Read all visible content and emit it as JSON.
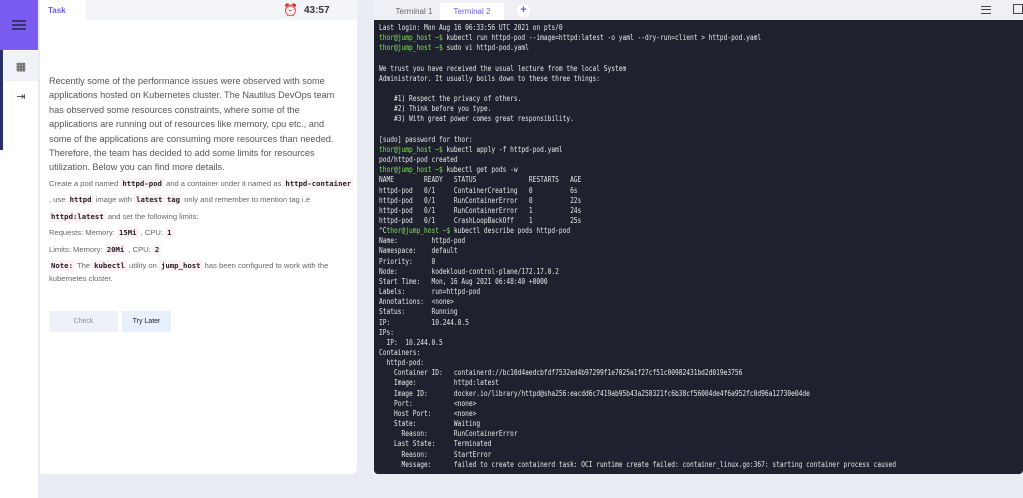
{
  "task_panel": {
    "tab": "Task",
    "timer": "43:57",
    "intro": "Recently some of the performance issues were observed with some applications hosted on Kubernetes cluster. The Nautilus DevOps team has observed some resources constraints, where some of the applications are running out of resources like memory, cpu etc., and some of the applications are consuming more resources than needed. Therefore, the team has decided to add some limits for resources utilization. Below you can find more details.",
    "d": {
      "t1": "Create a pod named ",
      "c1": "httpd-pod",
      "t2": " and a container under it named as ",
      "c2": "httpd-container",
      "t3": " , use ",
      "c3": "httpd",
      "t4": " image with ",
      "c4": "latest tag",
      "t5": " only and remember to mention tag i.e ",
      "c5": "httpd:latest",
      "t6": " and set the following limits:",
      "req_label": "Requests: Memory: ",
      "req_mem": "15Mi",
      "req_cpu_label": " , CPU: ",
      "req_cpu": "1",
      "lim_label": "Limits: Memory: ",
      "lim_mem": "20Mi",
      "lim_cpu_label": " , CPU: ",
      "lim_cpu": "2",
      "note": "Note:",
      "n1": " The ",
      "nc1": "kubectl",
      "n2": " utility on ",
      "nc2": "jump_host",
      "n3": " has been configured to work with the kubernetes cluster."
    },
    "check_button": "Check",
    "try_later_button": "Try Later"
  },
  "terminal": {
    "tabs": [
      "Terminal 1",
      "Terminal 2"
    ],
    "add_tab": "+",
    "prompt": "thor@jump_host ~$",
    "lines": [
      {
        "t": "Last login: Mon Aug 16 06:33:56 UTC 2021 on pts/0"
      },
      {
        "p": true,
        "t": " kubectl run httpd-pod --image=httpd:latest -o yaml --dry-run=client > httpd-pod.yaml"
      },
      {
        "p": true,
        "t": " sudo vi httpd-pod.yaml"
      },
      {
        "t": ""
      },
      {
        "t": "We trust you have received the usual lecture from the local System"
      },
      {
        "t": "Administrator. It usually boils down to these three things:"
      },
      {
        "t": ""
      },
      {
        "t": "    #1) Respect the privacy of others."
      },
      {
        "t": "    #2) Think before you type."
      },
      {
        "t": "    #3) With great power comes great responsibility."
      },
      {
        "t": ""
      },
      {
        "t": "[sudo] password for thor:"
      },
      {
        "p": true,
        "t": " kubectl apply -f httpd-pod.yaml"
      },
      {
        "t": "pod/httpd-pod created"
      },
      {
        "p": true,
        "t": " kubectl get pods -w"
      },
      {
        "t": "NAME        READY   STATUS              RESTARTS   AGE"
      },
      {
        "t": "httpd-pod   0/1     ContainerCreating   0          6s"
      },
      {
        "t": "httpd-pod   0/1     RunContainerError   0          22s"
      },
      {
        "t": "httpd-pod   0/1     RunContainerError   1          24s"
      },
      {
        "t": "httpd-pod   0/1     CrashLoopBackOff    1          25s"
      },
      {
        "pre": "^C",
        "p": true,
        "t": " kubectl describe pods httpd-pod"
      },
      {
        "t": "Name:         httpd-pod"
      },
      {
        "t": "Namespace:    default"
      },
      {
        "t": "Priority:     0"
      },
      {
        "t": "Node:         kodekloud-control-plane/172.17.0.2"
      },
      {
        "t": "Start Time:   Mon, 16 Aug 2021 06:48:40 +0000"
      },
      {
        "t": "Labels:       run=httpd-pod"
      },
      {
        "t": "Annotations:  <none>"
      },
      {
        "t": "Status:       Running"
      },
      {
        "t": "IP:           10.244.0.5"
      },
      {
        "t": "IPs:"
      },
      {
        "t": "  IP:  10.244.0.5"
      },
      {
        "t": "Containers:"
      },
      {
        "t": "  httpd-pod:"
      },
      {
        "t": "    Container ID:   containerd://bc10d4aedcbfdf7532ed4b97299f1e7025a1f27cf51c00982431bd2d019e3756"
      },
      {
        "t": "    Image:          httpd:latest"
      },
      {
        "t": "    Image ID:       docker.io/library/httpd@sha256:eacdd6c7419ab95b43a258321fc6b38cf56004de4f6a952fc0d96a12730e04de"
      },
      {
        "t": "    Port:           <none>"
      },
      {
        "t": "    Host Port:      <none>"
      },
      {
        "t": "    State:          Waiting"
      },
      {
        "t": "      Reason:       RunContainerError"
      },
      {
        "t": "    Last State:     Terminated"
      },
      {
        "t": "      Reason:       StartError"
      },
      {
        "t": "      Message:      failed to create containerd task: OCI runtime create failed: container_linux.go:367: starting container process caused"
      }
    ]
  }
}
